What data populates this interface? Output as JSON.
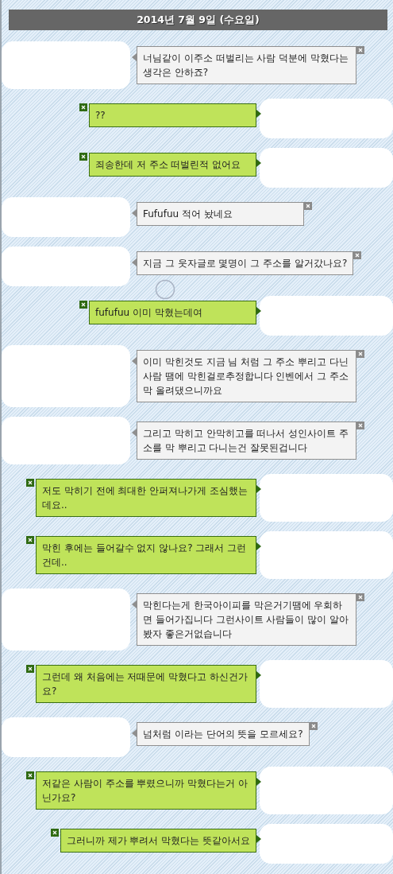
{
  "date_header": "2014년 7월 9일 (수요일)",
  "messages": [
    {
      "kind": "incoming",
      "text": "너님같이 이주소 떠벌리는 사람 덕분에 막혔다는 생각은 안하죠?"
    },
    {
      "kind": "outgoing",
      "text": "??"
    },
    {
      "kind": "outgoing",
      "text": "죄송한데 저 주소 떠벌린적 없어요"
    },
    {
      "kind": "incoming",
      "text": "Fufufuu 적어 놨네요"
    },
    {
      "kind": "incoming",
      "text": "지금 그 웃자글로 몇명이 그 주소를 알거갔나요?"
    },
    {
      "kind": "outgoing",
      "text": "fufufuu 이미 막혔는데여"
    },
    {
      "kind": "incoming",
      "text": "이미 막힌것도 지금 님 처럼 그 주소 뿌리고 다닌 사람 땜에 막힌걸로추정합니다 인벤에서 그 주소 막 올려댔으니까요"
    },
    {
      "kind": "incoming",
      "text": "그리고 막히고 안막히고를 떠나서 성인사이트 주소를 막 뿌리고 다니는건 잘못된겁니다"
    },
    {
      "kind": "outgoing",
      "text": "저도 막히기 전에 최대한 안퍼져나가게 조심했는데요.."
    },
    {
      "kind": "outgoing",
      "text": "막힌 후에는 들어갈수 없지 않나요? 그래서 그런건데.."
    },
    {
      "kind": "incoming",
      "text": "막힌다는게 한국아이피를 막은거기땜에 우회하면 들어가집니다 그런사이트 사람들이 많이 알아봤자 좋은거없습니다"
    },
    {
      "kind": "outgoing",
      "text": "그런데 왜 처음에는 저때문에 막혔다고 하신건가요?"
    },
    {
      "kind": "incoming",
      "text": "넘처럼 이라는 단어의 뜻을 모르세요?"
    },
    {
      "kind": "outgoing",
      "text": "저같은 사람이 주소를 뿌렸으니까 막혔다는거 아닌가요?"
    },
    {
      "kind": "outgoing",
      "text": "그러니까 제가 뿌려서 막혔다는 뜻같아서요"
    }
  ]
}
